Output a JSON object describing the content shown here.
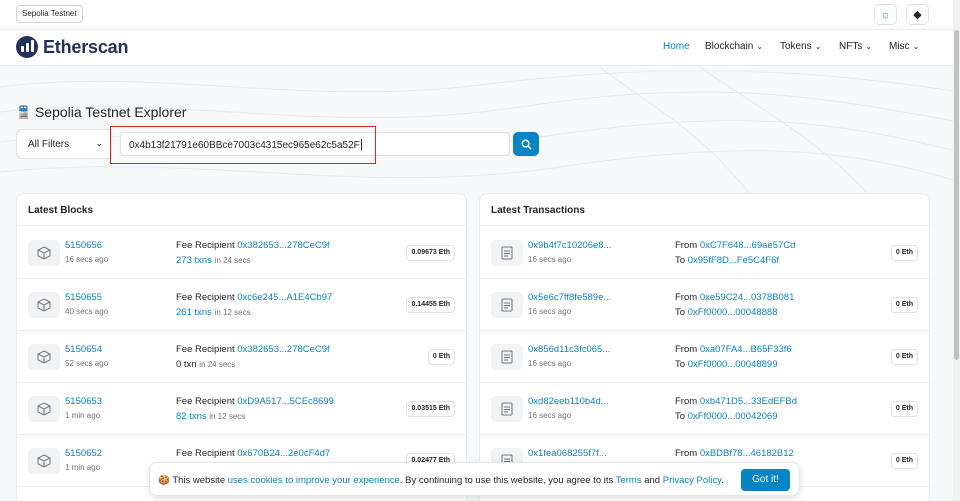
{
  "topbar": {
    "network_badge": "Sepolia Testnet",
    "theme_icon": "sun-icon",
    "network_icon": "ethereum-icon"
  },
  "nav": {
    "brand": "Etherscan",
    "items": [
      {
        "label": "Home",
        "active": true
      },
      {
        "label": "Blockchain"
      },
      {
        "label": "Tokens"
      },
      {
        "label": "NFTs"
      },
      {
        "label": "Misc"
      }
    ]
  },
  "hero": {
    "title": "Sepolia Testnet Explorer",
    "filter_value": "All Filters",
    "search_value": "0x4b13f21791e60BBce7003c4315ec965e62c5a52F"
  },
  "latest_blocks": {
    "title": "Latest Blocks",
    "fee_label": "Fee Recipient",
    "rows": [
      {
        "block": "5150656",
        "age": "16 secs ago",
        "recipient": "0x382653...278CeC9f",
        "txns": "273 txns",
        "time": "in 24 secs",
        "reward": "0.09673 Eth"
      },
      {
        "block": "5150655",
        "age": "40 secs ago",
        "recipient": "0xc6e245...A1E4Cb97",
        "txns": "261 txns",
        "time": "in 12 secs",
        "reward": "0.14455 Eth"
      },
      {
        "block": "5150654",
        "age": "52 secs ago",
        "recipient": "0x382653...278CeC9f",
        "txns": "0 txn",
        "time": "in 24 secs",
        "reward": "0 Eth"
      },
      {
        "block": "5150653",
        "age": "1 min ago",
        "recipient": "0xD9A517...5CEc8699",
        "txns": "82 txns",
        "time": "in 12 secs",
        "reward": "0.03515 Eth"
      },
      {
        "block": "5150652",
        "age": "1 min ago",
        "recipient": "0x670B24...2e0cF4d7",
        "txns": "",
        "time": "",
        "reward": "0.02477 Eth"
      }
    ]
  },
  "latest_txns": {
    "title": "Latest Transactions",
    "from_label": "From",
    "to_label": "To",
    "rows": [
      {
        "hash": "0x9b4f7c10206e8...",
        "age": "16 secs ago",
        "from": "0xC7F648...69ae57Cd",
        "to": "0x95fF8D...Fe5C4F6f",
        "value": "0 Eth"
      },
      {
        "hash": "0x5e6c7ff8fe589e...",
        "age": "16 secs ago",
        "from": "0xe59C24...0378B081",
        "to": "0xFf0000...00048888",
        "value": "0 Eth"
      },
      {
        "hash": "0x856d11c3fc065...",
        "age": "16 secs ago",
        "from": "0xa07FA4...B65F33f6",
        "to": "0xFf0000...00048899",
        "value": "0 Eth"
      },
      {
        "hash": "0xd82eeb110b4d...",
        "age": "16 secs ago",
        "from": "0xb471D5...33EdEFBd",
        "to": "0xFf0000...00042069",
        "value": "0 Eth"
      },
      {
        "hash": "0x1fea068255f7f...",
        "age": "",
        "from": "0xBDBf78...46182B12",
        "to": "",
        "value": "0 Eth"
      }
    ]
  },
  "cookie": {
    "t1": "This website ",
    "link1": "uses cookies to improve your experience",
    "t2": ". By continuing to use this website, you agree to its ",
    "link2": "Terms",
    "t3": " and ",
    "link3": "Privacy Policy",
    "t4": ".",
    "button": "Got it!"
  }
}
